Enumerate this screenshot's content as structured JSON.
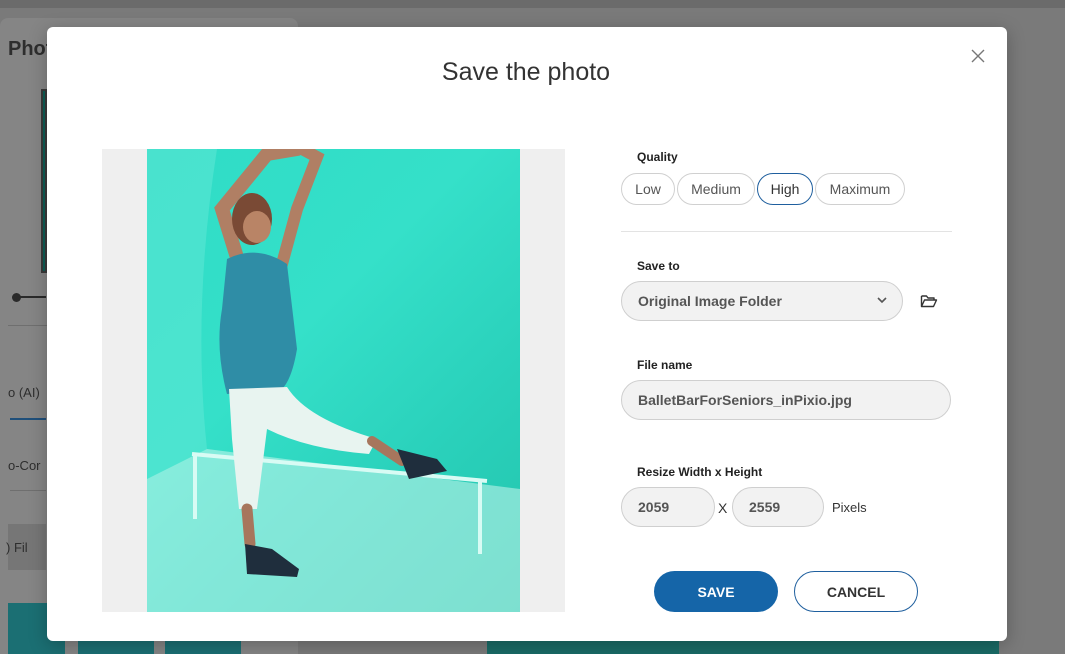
{
  "background": {
    "panel_title": "Phot",
    "tab_ai": "o (AI)",
    "tab_cor": "o-Cor",
    "row_fil": ") Fil"
  },
  "dialog": {
    "title": "Save the photo",
    "quality": {
      "label": "Quality",
      "options": [
        "Low",
        "Medium",
        "High",
        "Maximum"
      ],
      "selected": "High"
    },
    "save_to": {
      "label": "Save to",
      "value": "Original Image Folder"
    },
    "file_name": {
      "label": "File name",
      "value": "BalletBarForSeniors_inPixio.jpg"
    },
    "resize": {
      "label": "Resize Width x Height",
      "width": "2059",
      "height": "2559",
      "separator": "X",
      "unit": "Pixels"
    },
    "buttons": {
      "save": "SAVE",
      "cancel": "CANCEL"
    }
  },
  "colors": {
    "accent": "#1565a8",
    "photo_tint": "#2fdcc6"
  }
}
